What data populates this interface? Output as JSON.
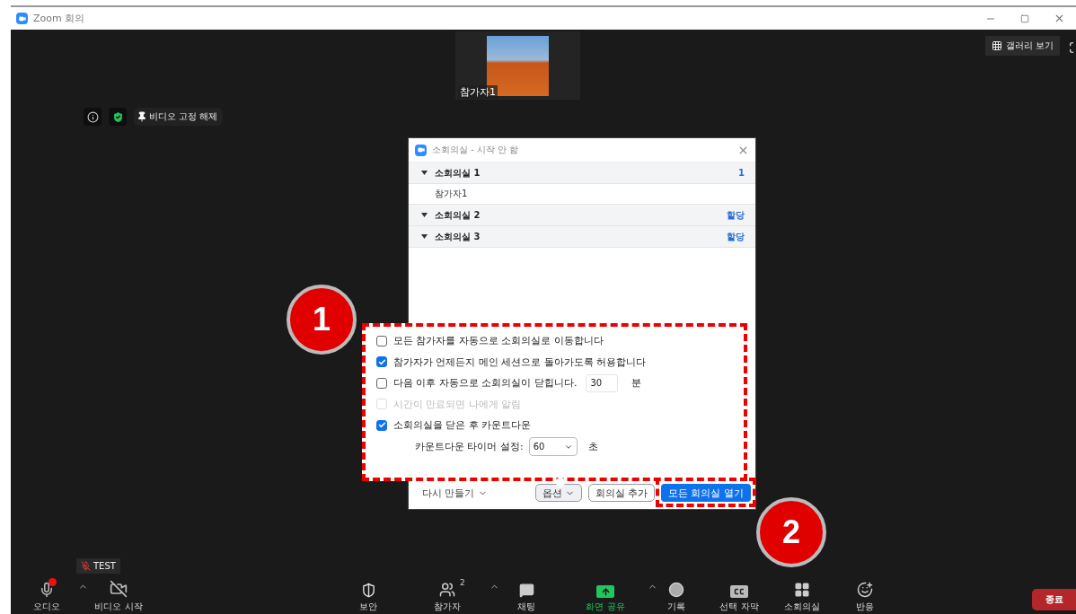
{
  "window": {
    "title": "Zoom 회의"
  },
  "stage": {
    "thumbnail_name": "참가자1",
    "gallery_button": "갤러리 보기",
    "pin_button": "비디오 고정 해제"
  },
  "breakout_dialog": {
    "title": "소회의실 - 시작 안 함",
    "rooms": [
      {
        "name": "소회의실 1",
        "action": "1",
        "participants": [
          "참가자1"
        ]
      },
      {
        "name": "소회의실 2",
        "action": "할당"
      },
      {
        "name": "소회의실 3",
        "action": "할당"
      }
    ],
    "footer": {
      "recreate": "다시 만들기",
      "options": "옵션",
      "add_room": "회의실 추가",
      "open_all": "모든 회의실 열기"
    }
  },
  "options_popup": {
    "items": [
      {
        "label": "모든 참가자를 자동으로 소회의실로 이동합니다",
        "checked": false,
        "disabled": false
      },
      {
        "label": "참가자가 언제든지 메인 세션으로 돌아가도록 허용합니다",
        "checked": true,
        "disabled": false
      },
      {
        "label": "다음 이후 자동으로 소회의실이 닫힙니다.",
        "checked": false,
        "disabled": false,
        "input": "30",
        "unit": "분"
      },
      {
        "label": "시간이 만료되면 나에게 알림",
        "checked": false,
        "disabled": true
      },
      {
        "label": "소회의실을 닫은 후 카운트다운",
        "checked": true,
        "disabled": false
      }
    ],
    "countdown": {
      "label": "카운트다운 타이머 설정:",
      "value": "60",
      "unit": "초"
    }
  },
  "annotations": [
    {
      "label": "1"
    },
    {
      "label": "2"
    }
  ],
  "toolbar": {
    "test_badge": "TEST",
    "left": [
      {
        "kind": "audio",
        "label": "오디오",
        "caret": true
      },
      {
        "kind": "video",
        "label": "비디오 시작",
        "caret": false
      }
    ],
    "center": [
      {
        "kind": "security",
        "label": "보안",
        "caret": false
      },
      {
        "kind": "participants",
        "label": "참가자",
        "caret": true,
        "count": "2"
      },
      {
        "kind": "chat",
        "label": "채팅",
        "caret": false
      },
      {
        "kind": "share",
        "label": "화면 공유",
        "caret": true
      },
      {
        "kind": "record",
        "label": "기록",
        "caret": false
      },
      {
        "kind": "captions",
        "label": "선택 자막",
        "caret": false
      },
      {
        "kind": "breakout",
        "label": "소회의실",
        "caret": false
      },
      {
        "kind": "reactions",
        "label": "반응",
        "caret": false
      }
    ],
    "end_button": "종료"
  }
}
